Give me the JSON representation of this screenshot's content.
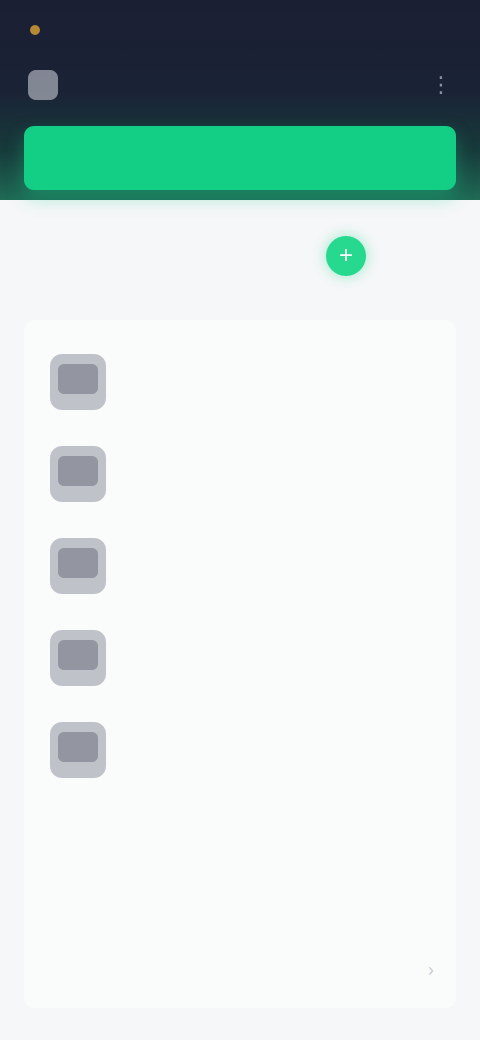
{
  "status_bar": {
    "time": "",
    "right_indicators": ""
  },
  "app_bar": {
    "title": "",
    "menu_icon": "menu-icon",
    "more_icon": "more-vertical-icon"
  },
  "cta": {
    "label": ""
  },
  "section_1": {
    "label": "",
    "add_icon": "plus-icon",
    "items": [
      {
        "title": "",
        "subtitle": "",
        "meta": ""
      },
      {
        "title": "",
        "subtitle": "",
        "meta": ""
      },
      {
        "title": "",
        "subtitle": "",
        "meta": ""
      },
      {
        "title": "",
        "subtitle": "",
        "meta": ""
      },
      {
        "title": "",
        "subtitle": "",
        "meta": ""
      }
    ]
  },
  "section_2": {
    "label": "",
    "row_text": "",
    "chevron_icon": "chevron-right-icon"
  },
  "colors": {
    "accent": "#13cf86",
    "header_top": "#1b1f33",
    "background": "#f6f7f8"
  }
}
